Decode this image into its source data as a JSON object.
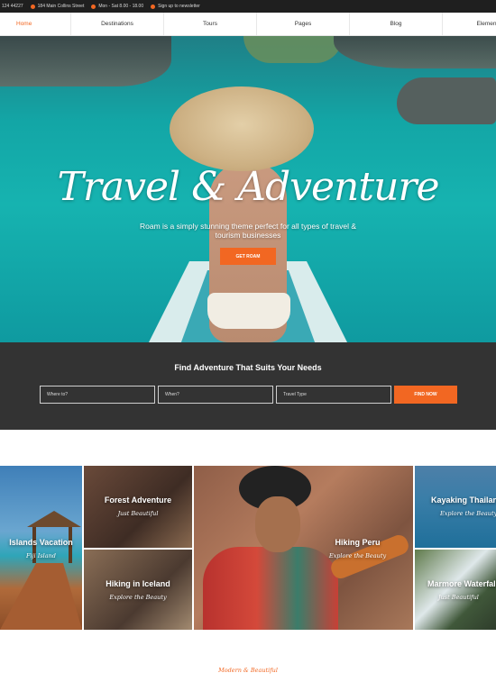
{
  "topbar": {
    "phone": "124 44227",
    "address": "184 Main Collins Street",
    "hours": "Mon - Sat 8.00 - 18.00",
    "newsletter": "Sign up to newsletter"
  },
  "nav": {
    "items": [
      "Home",
      "Destinations",
      "Tours",
      "Pages",
      "Blog",
      "Elements"
    ],
    "active": "Home"
  },
  "hero": {
    "title": "Travel & Adventure",
    "subtitle": "Roam is a simply stunning theme perfect for all types of travel & tourism businesses",
    "button": "GET ROAM"
  },
  "search": {
    "title": "Find Adventure That Suits Your Needs",
    "where_placeholder": "Where to?",
    "when_placeholder": "When?",
    "type_placeholder": "Travel Type",
    "button": "FIND NOW"
  },
  "tiles": [
    {
      "title": "Islands Vacation",
      "subtitle": "Fiji Island"
    },
    {
      "title": "Forest Adventure",
      "subtitle": "Just Beautiful"
    },
    {
      "title": "Hiking in Iceland",
      "subtitle": "Explore the Beauty"
    },
    {
      "title": "Hiking Peru",
      "subtitle": "Explore the Beauty"
    },
    {
      "title": "Kayaking Thailand",
      "subtitle": "Explore the Beauty"
    },
    {
      "title": "Marmore Waterfalls",
      "subtitle": "Just Beautiful"
    }
  ],
  "footer": {
    "tagline": "Modern & Beautiful"
  },
  "colors": {
    "accent": "#f26722",
    "dark": "#333333",
    "topbar": "#1f1f1f"
  }
}
